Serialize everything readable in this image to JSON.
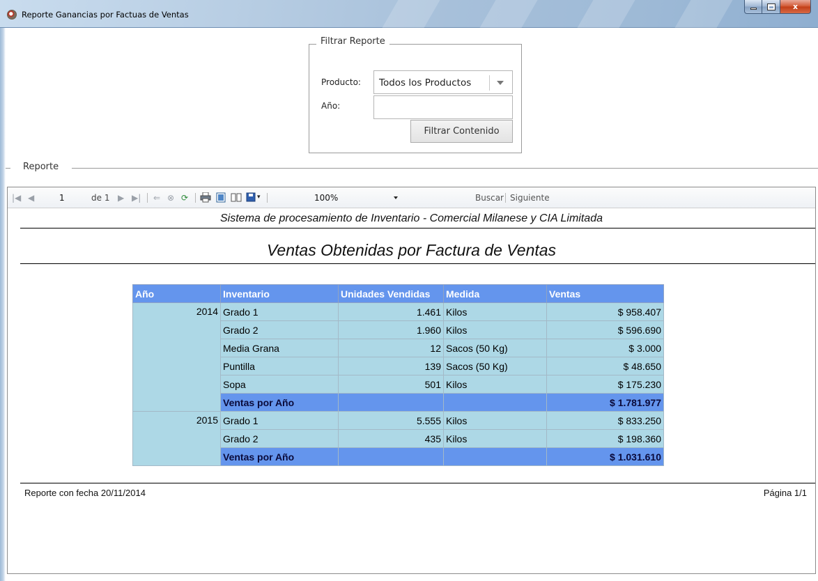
{
  "window": {
    "title": "Reporte Ganancias por Factuas de Ventas",
    "buttons": {
      "close": "x"
    }
  },
  "filter": {
    "legend": "Filtrar Reporte",
    "producto_label": "Producto:",
    "producto_value": "Todos los Productos",
    "anio_label": "Año:",
    "anio_value": "",
    "button_label": "Filtrar Contenido"
  },
  "reporte_legend": "Reporte",
  "viewer": {
    "toolbar": {
      "page_current": "1",
      "page_of": "de 1",
      "zoom": "100%",
      "buscar": "Buscar",
      "siguiente": "Siguiente"
    },
    "subtitle": "Sistema de procesamiento de Inventario - Comercial Milanese y CIA Limitada",
    "title": "Ventas Obtenidas por Factura de Ventas",
    "table": {
      "headers": [
        "Año",
        "Inventario",
        "Unidades Vendidas",
        "Medida",
        "Ventas"
      ],
      "groups": [
        {
          "year": "2014",
          "rows": [
            [
              "Grado 1",
              "1.461",
              "Kilos",
              "$ 958.407"
            ],
            [
              "Grado 2",
              "1.960",
              "Kilos",
              "$ 596.690"
            ],
            [
              "Media Grana",
              "12",
              "Sacos (50 Kg)",
              "$ 3.000"
            ],
            [
              "Puntilla",
              "139",
              "Sacos (50 Kg)",
              "$ 48.650"
            ],
            [
              "Sopa",
              "501",
              "Kilos",
              "$ 175.230"
            ]
          ],
          "subtotal_label": "Ventas por Año",
          "subtotal_value": "$ 1.781.977"
        },
        {
          "year": "2015",
          "rows": [
            [
              "Grado 1",
              "5.555",
              "Kilos",
              "$ 833.250"
            ],
            [
              "Grado 2",
              "435",
              "Kilos",
              "$ 198.360"
            ]
          ],
          "subtotal_label": "Ventas por Año",
          "subtotal_value": "$ 1.031.610"
        }
      ]
    },
    "footer_left": "Reporte con fecha 20/11/2014",
    "footer_right": "Página 1/1"
  },
  "colors": {
    "header": "#6495ed",
    "cell": "#add8e6"
  }
}
